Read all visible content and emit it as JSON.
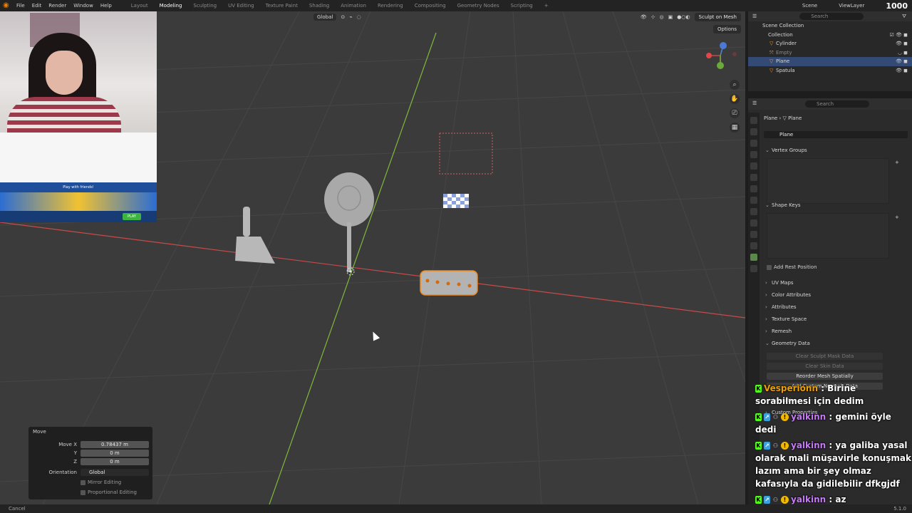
{
  "topbar": {
    "menus": [
      "File",
      "Edit",
      "Render",
      "Window",
      "Help"
    ],
    "workspaces": [
      "Layout",
      "Modeling",
      "Sculpting",
      "UV Editing",
      "Texture Paint",
      "Shading",
      "Animation",
      "Rendering",
      "Compositing",
      "Geometry Nodes",
      "Scripting"
    ],
    "active_workspace": "Modeling",
    "scene": "Scene",
    "view_layer": "ViewLayer",
    "viewer_count": "1000"
  },
  "viewport_header": {
    "orientation": "Global",
    "sculpt_button": "Sculpt on Mesh",
    "options": "Options"
  },
  "move_panel": {
    "title": "Move",
    "move_x_label": "Move X",
    "move_x": "0.78437 m",
    "y_label": "Y",
    "y": "0 m",
    "z_label": "Z",
    "z": "0 m",
    "orientation_label": "Orientation",
    "orientation": "Global",
    "mirror": "Mirror Editing",
    "proportional": "Proportional Editing"
  },
  "statusbar": {
    "left": "Cancel",
    "version": "5.1.0"
  },
  "outliner": {
    "search_placeholder": "Search",
    "scene_collection": "Scene Collection",
    "collection": "Collection",
    "items": [
      {
        "name": "Cylinder",
        "selected": false,
        "dim": false
      },
      {
        "name": "Empty",
        "selected": false,
        "dim": true
      },
      {
        "name": "Plane",
        "selected": true,
        "dim": false
      },
      {
        "name": "Spatula",
        "selected": false,
        "dim": false
      }
    ]
  },
  "properties": {
    "search_placeholder": "Search",
    "breadcrumb_object": "Plane",
    "breadcrumb_data": "Plane",
    "mesh_name": "Plane",
    "sections": {
      "vertex_groups": "Vertex Groups",
      "shape_keys": "Shape Keys",
      "add_rest_position": "Add Rest Position",
      "uv_maps": "UV Maps",
      "color_attributes": "Color Attributes",
      "attributes": "Attributes",
      "texture_space": "Texture Space",
      "remesh": "Remesh",
      "geometry_data": "Geometry Data",
      "clear_sculpt_mask": "Clear Sculpt Mask Data",
      "clear_skin": "Clear Skin Data",
      "reorder_mesh": "Reorder Mesh Spatially",
      "add_custom_normals": "Add Custom Normals Data",
      "animation": "Animation",
      "custom_properties": "Custom Properties"
    }
  },
  "webcam_game": {
    "banner": "Play with friends!",
    "play": "PLAY"
  },
  "chat": [
    {
      "user": "Vesperionn",
      "text": "Birine sorabilmesi için dedim"
    },
    {
      "user": "yalkinn",
      "text": "gemini öyle dedi"
    },
    {
      "user": "yalkinn",
      "text": "ya galiba yasal olarak mali müşavirle konuşmak lazım ama bir şey olmaz kafasıyla da gidilebilir dfkgjdf"
    },
    {
      "user": "yalkinn",
      "text": "az kazanacağımız için radara takılmaz belki"
    }
  ],
  "colors": {
    "accent": "#e87d0d",
    "selection": "#334a74",
    "x_axis": "#c84a4a",
    "y_axis": "#7fb83a"
  }
}
